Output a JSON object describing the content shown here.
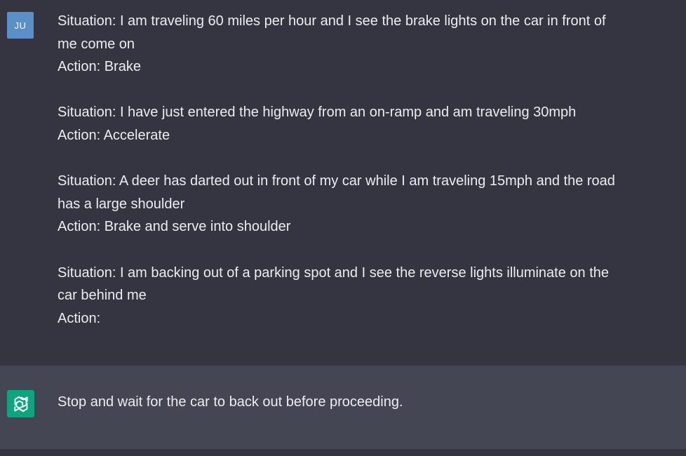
{
  "user_message": {
    "avatar_initials": "JU",
    "avatar_color": "#5a8fc7",
    "lines": [
      "Situation: I am traveling 60 miles per hour and I see the brake lights on the car in front of",
      "me come on",
      "Action: Brake",
      "",
      "Situation: I have just entered the highway from an on-ramp and am traveling 30mph",
      "Action: Accelerate",
      "",
      "Situation: A deer has darted out in front of my car while I am traveling 15mph and the road",
      "has a large shoulder",
      "Action: Brake and serve into shoulder",
      "",
      "Situation: I am backing out of a parking spot and I see the reverse lights illuminate on the",
      "car behind me",
      "Action:"
    ]
  },
  "assistant_message": {
    "avatar_icon": "openai-logo-icon",
    "avatar_color": "#10a37f",
    "text": "Stop and wait for the car to back out before proceeding."
  },
  "colors": {
    "user_background": "#343541",
    "assistant_background": "#444654",
    "text": "#ececf1"
  }
}
